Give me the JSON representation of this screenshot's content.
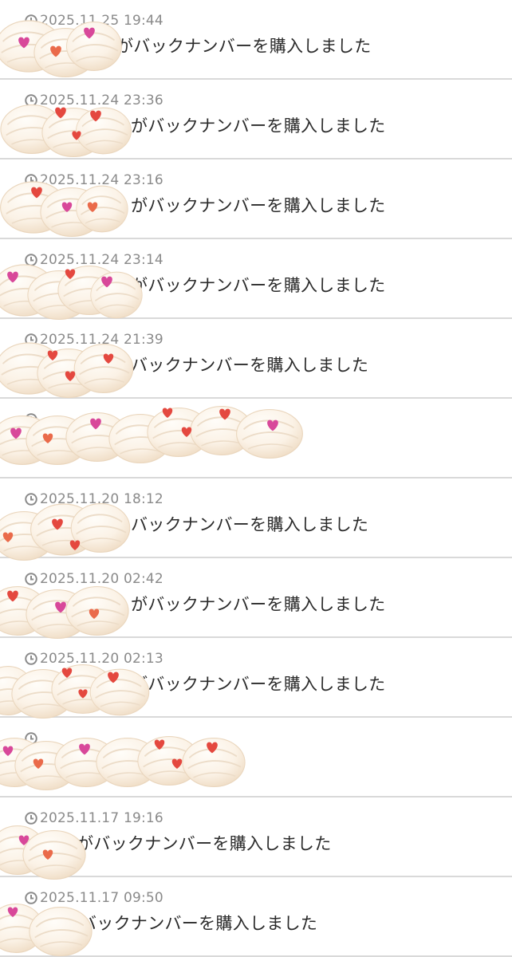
{
  "rows": [
    {
      "ts": "2025.11.25 19:44",
      "msg": "がバックナンバーを購入しました"
    },
    {
      "ts": "2025.11.24 23:36",
      "msg": "がバックナンバーを購入しました"
    },
    {
      "ts": "2025.11.24 23:16",
      "msg": "がバックナンバーを購入しました"
    },
    {
      "ts": "2025.11.24 23:14",
      "msg": "がバックナンバーを購入しました"
    },
    {
      "ts": "2025.11.24 21:39",
      "msg": "バックナンバーを購入しました"
    },
    {
      "ts": "",
      "msg": ""
    },
    {
      "ts": "2025.11.20 18:12",
      "msg": "バックナンバーを購入しました"
    },
    {
      "ts": "2025.11.20 02:42",
      "msg": "がバックナンバーを購入しました"
    },
    {
      "ts": "2025.11.20 02:13",
      "msg": "がバックナンバーを購入しました"
    },
    {
      "ts": "",
      "msg": ""
    },
    {
      "ts": "2025.11.17 19:16",
      "msg": "がバックナンバーを購入しました"
    },
    {
      "ts": "2025.11.17 09:50",
      "msg": "バックナンバーを購入しました"
    }
  ],
  "colors": {
    "divider": "#d9d9d9",
    "timestamp": "#8a8a8a",
    "message": "#2b2b2b",
    "cream": "#f7ecdd",
    "heart_red": "#e4483f",
    "heart_pink": "#d8489a",
    "heart_orange": "#ea6a4a"
  },
  "icons": {
    "timestamp_icon": "clock-icon",
    "overlay_sticker": "whipped-cream-heart-sticker"
  }
}
